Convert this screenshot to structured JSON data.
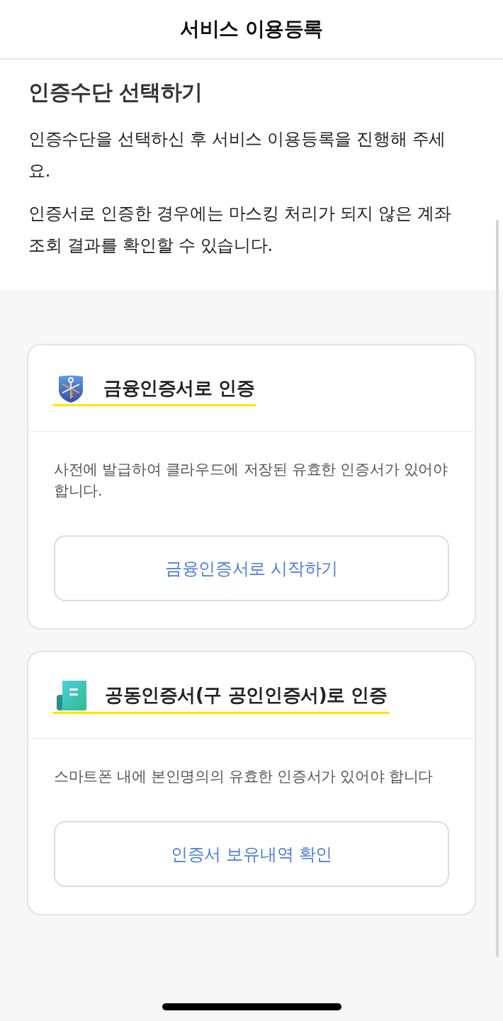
{
  "header": {
    "title": "서비스 이용등록"
  },
  "intro": {
    "title": "인증수단 선택하기",
    "paragraphs": [
      "인증수단을 선택하신 후 서비스 이용등록을 진행해 주세요.",
      "인증서로 인증한 경우에는 마스킹 처리가 되지 않은 계좌 조회 결과를 확인할 수 있습니다."
    ]
  },
  "methods": [
    {
      "kind": "financial",
      "title": "금융인증서로 인증",
      "underlined": true,
      "description": "사전에 발급하여 클라우드에 저장된 유효한 인증서가 있어야 합니다.",
      "button": "금융인증서로 시작하기"
    },
    {
      "kind": "joint",
      "title": "공동인증서(구 공인인증서)로 인증",
      "underlined": true,
      "description": "스마트폰 내에 본인명의의 유효한 인증서가 있어야 합니다",
      "button": "인증서 보유내역 확인"
    }
  ]
}
